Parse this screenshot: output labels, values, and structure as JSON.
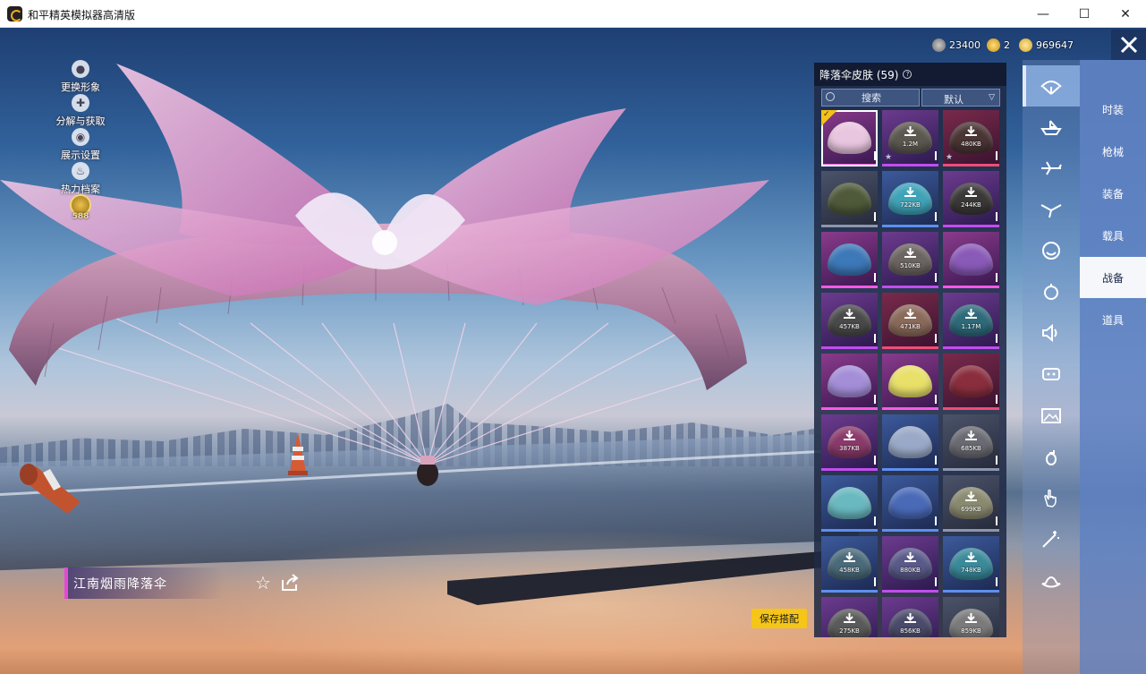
{
  "window": {
    "title": "和平精英模拟器高清版",
    "min_glyph": "—",
    "max_glyph": "☐",
    "close_glyph": "✕"
  },
  "currencies": [
    {
      "icon": "silver-coin-icon",
      "value": "23400"
    },
    {
      "icon": "gold-badge-icon",
      "value": "2"
    },
    {
      "icon": "gold-coin-icon",
      "value": "969647"
    }
  ],
  "left_tools": [
    {
      "icon": "avatar-icon",
      "label": "更换形象"
    },
    {
      "icon": "puzzle-icon",
      "label": "分解与获取"
    },
    {
      "icon": "eye-icon",
      "label": "展示设置"
    },
    {
      "icon": "flame-icon",
      "label": "热力档案"
    }
  ],
  "medal": {
    "value": "588"
  },
  "item": {
    "name": "江南烟雨降落伞"
  },
  "save_button": "保存搭配",
  "panel": {
    "title": "降落伞皮肤 (59)",
    "help_glyph": "?",
    "search_label": "搜索",
    "sort_label": "默认",
    "tiles": [
      {
        "rarity": "r-pink",
        "color": "#e9c6df",
        "size": "",
        "download": false,
        "selected": true,
        "star": false
      },
      {
        "rarity": "r-purple",
        "color": "#5b5850",
        "size": "1.2M",
        "download": true,
        "selected": false,
        "star": true
      },
      {
        "rarity": "r-red",
        "color": "#4a3434",
        "size": "480KB",
        "download": true,
        "selected": false,
        "star": true
      },
      {
        "rarity": "r-gray",
        "color": "#4f5a3a",
        "size": "",
        "download": false,
        "selected": false,
        "star": false
      },
      {
        "rarity": "r-blue",
        "color": "#3fa3b8",
        "size": "722KB",
        "download": true,
        "selected": false,
        "star": false
      },
      {
        "rarity": "r-purple",
        "color": "#3b3838",
        "size": "244KB",
        "download": true,
        "selected": false,
        "star": false
      },
      {
        "rarity": "r-pink",
        "color": "#3d78b8",
        "size": "",
        "download": false,
        "selected": false,
        "star": false
      },
      {
        "rarity": "r-purple",
        "color": "#6b6460",
        "size": "510KB",
        "download": true,
        "selected": false,
        "star": false
      },
      {
        "rarity": "r-pink",
        "color": "#8a5ab8",
        "size": "",
        "download": false,
        "selected": false,
        "star": false
      },
      {
        "rarity": "r-purple",
        "color": "#4a4a4a",
        "size": "457KB",
        "download": true,
        "selected": false,
        "star": false
      },
      {
        "rarity": "r-red",
        "color": "#8a6a5a",
        "size": "471KB",
        "download": true,
        "selected": false,
        "star": false
      },
      {
        "rarity": "r-purple",
        "color": "#2e6a7a",
        "size": "1.17M",
        "download": true,
        "selected": false,
        "star": false
      },
      {
        "rarity": "r-pink",
        "color": "#a48ed8",
        "size": "",
        "download": false,
        "selected": false,
        "star": false
      },
      {
        "rarity": "r-pink",
        "color": "#e9e06a",
        "size": "",
        "download": false,
        "selected": false,
        "star": false
      },
      {
        "rarity": "r-red",
        "color": "#8a2e3e",
        "size": "",
        "download": false,
        "selected": false,
        "star": false
      },
      {
        "rarity": "r-purple",
        "color": "#8a3a6a",
        "size": "387KB",
        "download": true,
        "selected": false,
        "star": false
      },
      {
        "rarity": "r-blue",
        "color": "#9aa9c8",
        "size": "",
        "download": false,
        "selected": false,
        "star": false
      },
      {
        "rarity": "r-gray",
        "color": "#6a6a72",
        "size": "685KB",
        "download": true,
        "selected": false,
        "star": false
      },
      {
        "rarity": "r-blue",
        "color": "#6ab8c0",
        "size": "",
        "download": false,
        "selected": false,
        "star": false
      },
      {
        "rarity": "r-blue",
        "color": "#4a6ab8",
        "size": "",
        "download": false,
        "selected": false,
        "star": false
      },
      {
        "rarity": "r-gray",
        "color": "#8a8a70",
        "size": "699KB",
        "download": true,
        "selected": false,
        "star": false
      },
      {
        "rarity": "r-blue",
        "color": "#4a6a7a",
        "size": "458KB",
        "download": true,
        "selected": false,
        "star": false
      },
      {
        "rarity": "r-purple",
        "color": "#5a5a8a",
        "size": "880KB",
        "download": true,
        "selected": false,
        "star": false
      },
      {
        "rarity": "r-blue",
        "color": "#3a8a9a",
        "size": "748KB",
        "download": true,
        "selected": false,
        "star": false
      },
      {
        "rarity": "r-purple",
        "color": "#5a5a5a",
        "size": "275KB",
        "download": true,
        "selected": false,
        "star": false
      },
      {
        "rarity": "r-purple",
        "color": "#4a4a6a",
        "size": "856KB",
        "download": true,
        "selected": false,
        "star": false
      },
      {
        "rarity": "r-gray",
        "color": "#7a7a7a",
        "size": "859KB",
        "download": true,
        "selected": false,
        "star": false
      }
    ]
  },
  "category_icons": [
    "parachute-icon",
    "boat-icon",
    "plane-icon",
    "glider-icon",
    "emote-icon",
    "companion-icon",
    "voice-icon",
    "vehicle-icon",
    "photo-icon",
    "grenade-icon",
    "hand-icon",
    "magic-icon",
    "hat-icon"
  ],
  "tabs": [
    {
      "label": "时装",
      "active": false
    },
    {
      "label": "枪械",
      "active": false
    },
    {
      "label": "装备",
      "active": false
    },
    {
      "label": "载具",
      "active": false
    },
    {
      "label": "战备",
      "active": true
    },
    {
      "label": "道具",
      "active": false
    }
  ]
}
